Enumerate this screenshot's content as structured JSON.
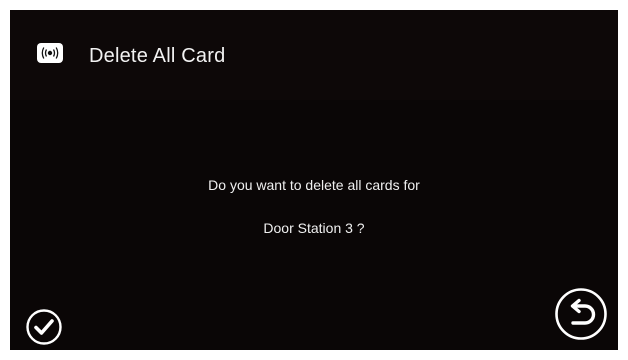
{
  "header": {
    "title": "Delete All Card",
    "icon": "card-reader-icon"
  },
  "message": {
    "line1": "Do you want to delete all cards for",
    "line2": "Door Station 3 ?"
  },
  "buttons": {
    "confirm_icon": "check-icon",
    "back_icon": "return-arrow-icon"
  },
  "colors": {
    "background": "#0a0606",
    "text": "#ffffff"
  }
}
